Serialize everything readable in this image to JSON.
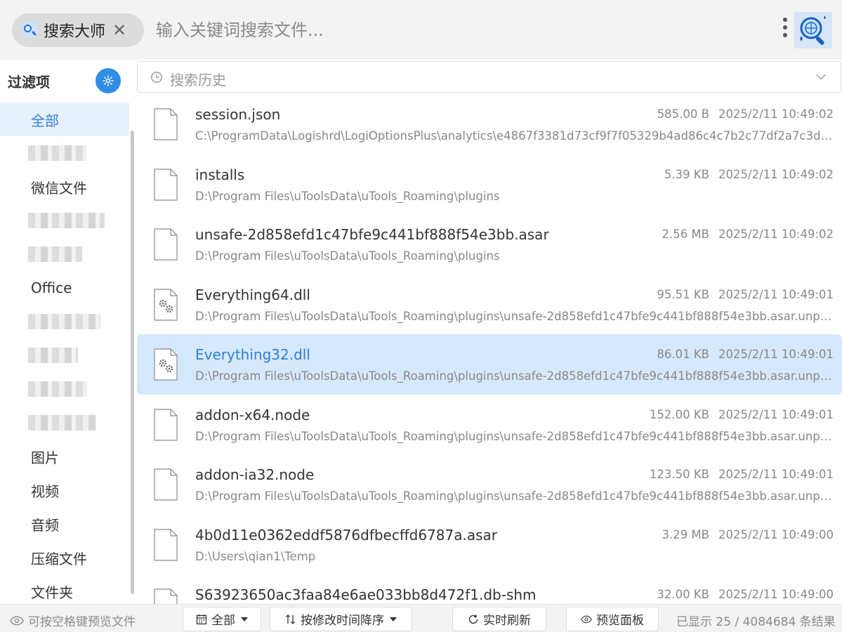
{
  "topbar": {
    "app_name": "搜索大师",
    "close_symbol": "✕",
    "search_placeholder": "输入关键词搜索文件...",
    "search_value": ""
  },
  "sidebar": {
    "title": "过滤项",
    "items": [
      {
        "label": "全部",
        "active": true,
        "blurred": false
      },
      {
        "label": "",
        "active": false,
        "blurred": true
      },
      {
        "label": "微信文件",
        "active": false,
        "blurred": false
      },
      {
        "label": "",
        "active": false,
        "blurred": true
      },
      {
        "label": "",
        "active": false,
        "blurred": true
      },
      {
        "label": "Office",
        "active": false,
        "blurred": false
      },
      {
        "label": "",
        "active": false,
        "blurred": true
      },
      {
        "label": "",
        "active": false,
        "blurred": true
      },
      {
        "label": "",
        "active": false,
        "blurred": true
      },
      {
        "label": "",
        "active": false,
        "blurred": true
      },
      {
        "label": "图片",
        "active": false,
        "blurred": false
      },
      {
        "label": "视频",
        "active": false,
        "blurred": false
      },
      {
        "label": "音频",
        "active": false,
        "blurred": false
      },
      {
        "label": "压缩文件",
        "active": false,
        "blurred": false
      },
      {
        "label": "文件夹",
        "active": false,
        "blurred": false
      }
    ]
  },
  "history": {
    "label": "搜索历史"
  },
  "results": [
    {
      "name": "session.json",
      "path": "C:\\ProgramData\\Logishrd\\LogiOptionsPlus\\analytics\\e4867f3381d73cf9f7f05329b4ad86c4c7b2c77df2a7c3df4c2...",
      "size": "585.00 B",
      "time": "2025/2/11 10:49:02",
      "icon": "file-icon",
      "selected": false
    },
    {
      "name": "installs",
      "path": "D:\\Program Files\\uToolsData\\uTools_Roaming\\plugins",
      "size": "5.39 KB",
      "time": "2025/2/11 10:49:02",
      "icon": "file-icon",
      "selected": false
    },
    {
      "name": "unsafe-2d858efd1c47bfe9c441bf888f54e3bb.asar",
      "path": "D:\\Program Files\\uToolsData\\uTools_Roaming\\plugins",
      "size": "2.56 MB",
      "time": "2025/2/11 10:49:02",
      "icon": "file-icon",
      "selected": false
    },
    {
      "name": "Everything64.dll",
      "path": "D:\\Program Files\\uToolsData\\uTools_Roaming\\plugins\\unsafe-2d858efd1c47bfe9c441bf888f54e3bb.asar.unpacke...",
      "size": "95.51 KB",
      "time": "2025/2/11 10:49:01",
      "icon": "dll-file-icon",
      "selected": false
    },
    {
      "name": "Everything32.dll",
      "path": "D:\\Program Files\\uToolsData\\uTools_Roaming\\plugins\\unsafe-2d858efd1c47bfe9c441bf888f54e3bb.asar.unpacke...",
      "size": "86.01 KB",
      "time": "2025/2/11 10:49:01",
      "icon": "dll-file-icon",
      "selected": true
    },
    {
      "name": "addon-x64.node",
      "path": "D:\\Program Files\\uToolsData\\uTools_Roaming\\plugins\\unsafe-2d858efd1c47bfe9c441bf888f54e3bb.asar.unpacke...",
      "size": "152.00 KB",
      "time": "2025/2/11 10:49:01",
      "icon": "file-icon",
      "selected": false
    },
    {
      "name": "addon-ia32.node",
      "path": "D:\\Program Files\\uToolsData\\uTools_Roaming\\plugins\\unsafe-2d858efd1c47bfe9c441bf888f54e3bb.asar.unpacke...",
      "size": "123.50 KB",
      "time": "2025/2/11 10:49:01",
      "icon": "file-icon",
      "selected": false
    },
    {
      "name": "4b0d11e0362eddf5876dfbecffd6787a.asar",
      "path": "D:\\Users\\qian1\\Temp",
      "size": "3.29 MB",
      "time": "2025/2/11 10:49:00",
      "icon": "file-icon",
      "selected": false
    },
    {
      "name": "S63923650ac3faa84e6ae033bb8d472f1.db-shm",
      "path": "",
      "size": "32.00 KB",
      "time": "2025/2/11 10:49:00",
      "icon": "file-icon",
      "selected": false
    }
  ],
  "footer": {
    "hint": "可按空格键预览文件",
    "filter_label": "全部",
    "sort_label": "按修改时间降序",
    "refresh_label": "实时刷新",
    "preview_label": "预览面板",
    "count_text": "已显示 25 / 4084684 条结果"
  },
  "colors": {
    "accent": "#2f8de6",
    "selected_row": "#d6e8fb",
    "active_filter_bg": "#e8f1fb"
  }
}
